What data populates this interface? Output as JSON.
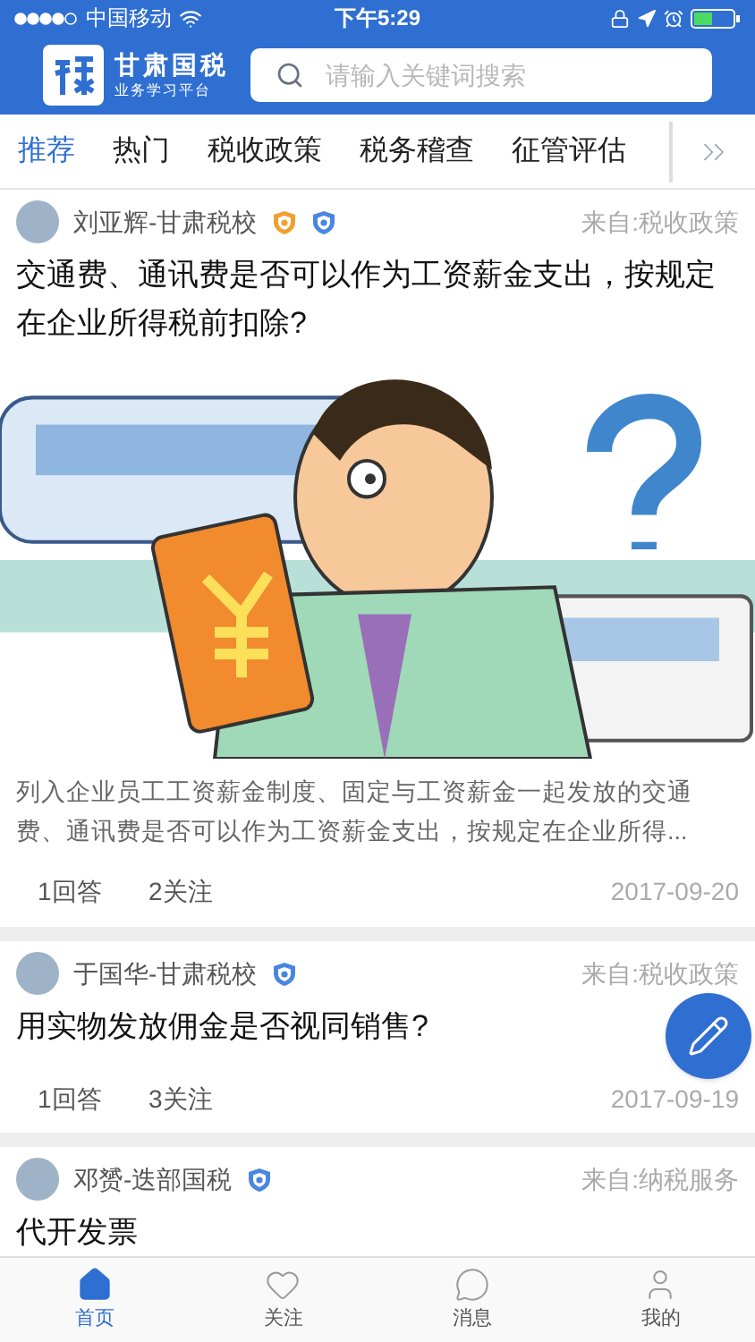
{
  "status_bar": {
    "carrier": "中国移动",
    "time": "下午5:29"
  },
  "header": {
    "logo_title": "甘肃国税",
    "logo_subtitle": "业务学习平台",
    "search": {
      "placeholder": "请输入关键词搜索"
    }
  },
  "tabs": [
    {
      "label": "推荐",
      "selected": true
    },
    {
      "label": "热门",
      "selected": false
    },
    {
      "label": "税收政策",
      "selected": false
    },
    {
      "label": "税务稽查",
      "selected": false
    },
    {
      "label": "征管评估",
      "selected": false
    }
  ],
  "posts": [
    {
      "author": "刘亚辉-甘肃税校",
      "badges": [
        {
          "color": "#f0a030"
        },
        {
          "color": "#4a86e0"
        }
      ],
      "source": "来自:税收政策",
      "title": "交通费、通讯费是否可以作为工资薪金支出，按规定在企业所得税前扣除?",
      "has_image": true,
      "excerpt": "列入企业员工工资薪金制度、固定与工资薪金一起发放的交通费、通讯费是否可以作为工资薪金支出，按规定在企业所得...",
      "answers": "1回答",
      "follows": "2关注",
      "date": "2017-09-20"
    },
    {
      "author": "于国华-甘肃税校",
      "badges": [
        {
          "color": "#4a86e0"
        }
      ],
      "source": "来自:税收政策",
      "title": "用实物发放佣金是否视同销售?",
      "has_image": false,
      "answers": "1回答",
      "follows": "3关注",
      "date": "2017-09-19"
    },
    {
      "author": "邓赟-迭部国税",
      "badges": [
        {
          "color": "#4a86e0"
        }
      ],
      "source": "来自:纳税服务",
      "title": "代开发票",
      "has_image": false
    }
  ],
  "bottom_nav": [
    {
      "label": "首页",
      "kind": "home",
      "selected": true
    },
    {
      "label": "关注",
      "kind": "heart",
      "selected": false
    },
    {
      "label": "消息",
      "kind": "chat",
      "selected": false
    },
    {
      "label": "我的",
      "kind": "user",
      "selected": false
    }
  ]
}
